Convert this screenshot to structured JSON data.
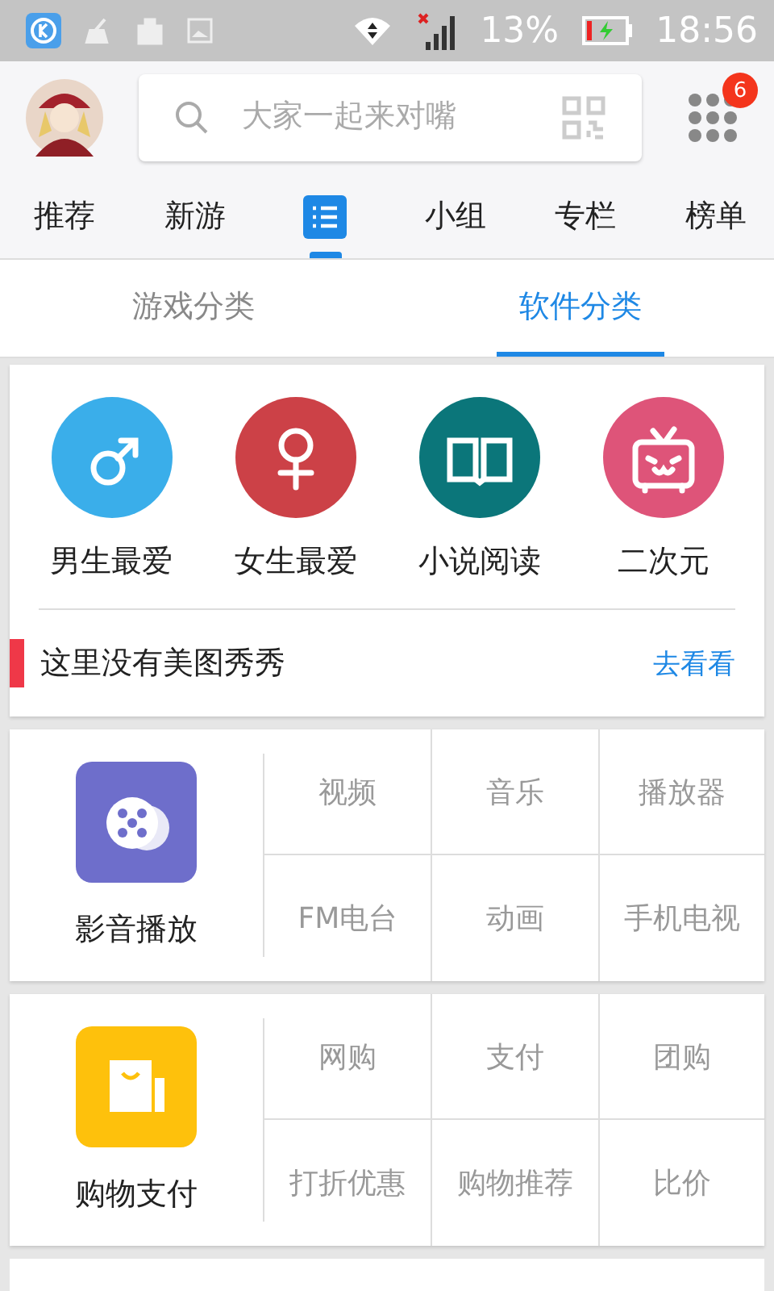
{
  "status_bar": {
    "battery": "13%",
    "time": "18:56"
  },
  "header": {
    "search": {
      "placeholder": "大家一起来对嘴"
    },
    "badge": "6"
  },
  "nav": [
    {
      "kind": "text",
      "label": "推荐",
      "selected": false
    },
    {
      "kind": "text",
      "label": "新游",
      "selected": false
    },
    {
      "kind": "icon",
      "selected": true
    },
    {
      "kind": "text",
      "label": "小组",
      "selected": false
    },
    {
      "kind": "text",
      "label": "专栏",
      "selected": false
    },
    {
      "kind": "text",
      "label": "榜单",
      "selected": false
    }
  ],
  "sub_tabs": [
    {
      "label": "游戏分类",
      "selected": false
    },
    {
      "label": "软件分类",
      "selected": true
    }
  ],
  "features": [
    {
      "kind": "male",
      "label": "男生最爱",
      "color": "#3aaeea"
    },
    {
      "kind": "female",
      "label": "女生最爱",
      "color": "#cc4147"
    },
    {
      "kind": "book",
      "label": "小说阅读",
      "color": "#0b767a"
    },
    {
      "kind": "tv",
      "label": "二次元",
      "color": "#de5479"
    }
  ],
  "notice": {
    "text": "这里没有美图秀秀",
    "link": "去看看"
  },
  "categories": [
    {
      "kind": "film",
      "name": "影音播放",
      "color": "#6e6ecb",
      "items": [
        "视频",
        "音乐",
        "播放器",
        "FM电台",
        "动画",
        "手机电视"
      ]
    },
    {
      "kind": "bag",
      "name": "购物支付",
      "color": "#fec10c",
      "items": [
        "网购",
        "支付",
        "团购",
        "打折优惠",
        "购物推荐",
        "比价"
      ]
    }
  ]
}
